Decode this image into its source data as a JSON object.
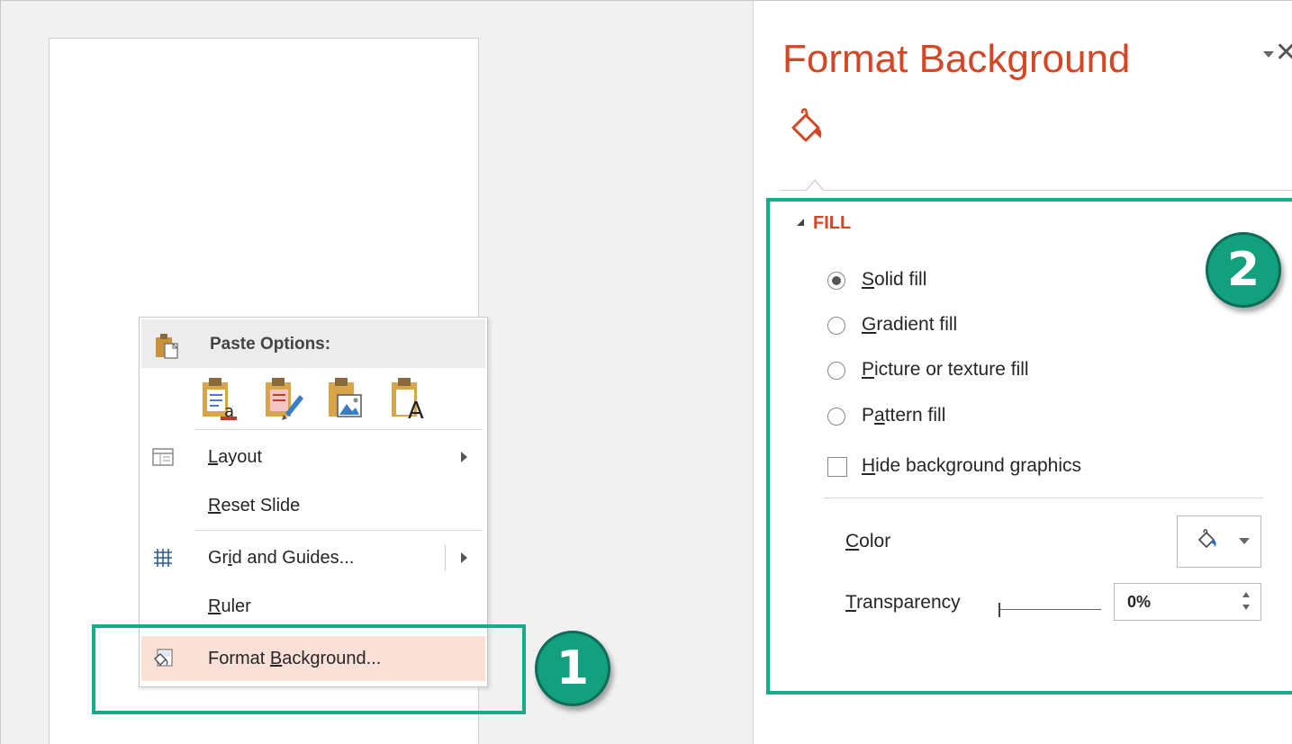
{
  "context_menu": {
    "paste_options_label": "Paste Options:",
    "paste_icons": [
      "paste-use-destination-theme-icon",
      "paste-keep-source-formatting-icon",
      "paste-picture-icon",
      "paste-keep-text-only-icon"
    ],
    "items": [
      {
        "label_pre": "",
        "label_key": "L",
        "label_post": "ayout",
        "icon": "layout-icon",
        "submenu": true
      },
      {
        "label_pre": "",
        "label_key": "R",
        "label_post": "eset Slide",
        "icon": "",
        "submenu": false
      },
      {
        "label_pre": "Gr",
        "label_key": "i",
        "label_post": "d and Guides...",
        "icon": "grid-icon",
        "submenu": true
      },
      {
        "label_pre": "",
        "label_key": "R",
        "label_post": "uler",
        "icon": "",
        "submenu": false
      },
      {
        "label_pre": "Format ",
        "label_key": "B",
        "label_post": "ackground...",
        "icon": "format-background-icon",
        "submenu": false,
        "highlighted": true
      }
    ]
  },
  "callouts": {
    "badge_1": "1",
    "badge_2": "2",
    "color": "#12a07f"
  },
  "pane": {
    "title": "Format Background",
    "section_label": "FILL",
    "fill_options": [
      {
        "key": "S",
        "rest": "olid fill",
        "pre": "",
        "checked": true
      },
      {
        "key": "G",
        "rest": "radient fill",
        "pre": "",
        "checked": false
      },
      {
        "key": "P",
        "rest": "icture or texture fill",
        "pre": "",
        "checked": false
      },
      {
        "key": "a",
        "rest": "ttern fill",
        "pre": "P",
        "checked": false
      }
    ],
    "hide_graphics": {
      "key": "H",
      "rest": "ide background graphics",
      "checked": false
    },
    "color_label_key": "C",
    "color_label_rest": "olor",
    "transparency_label_key": "T",
    "transparency_label_rest": "ransparency",
    "transparency_value": "0%",
    "transparency_fraction": 0.0,
    "accent_color": "#d24726"
  }
}
